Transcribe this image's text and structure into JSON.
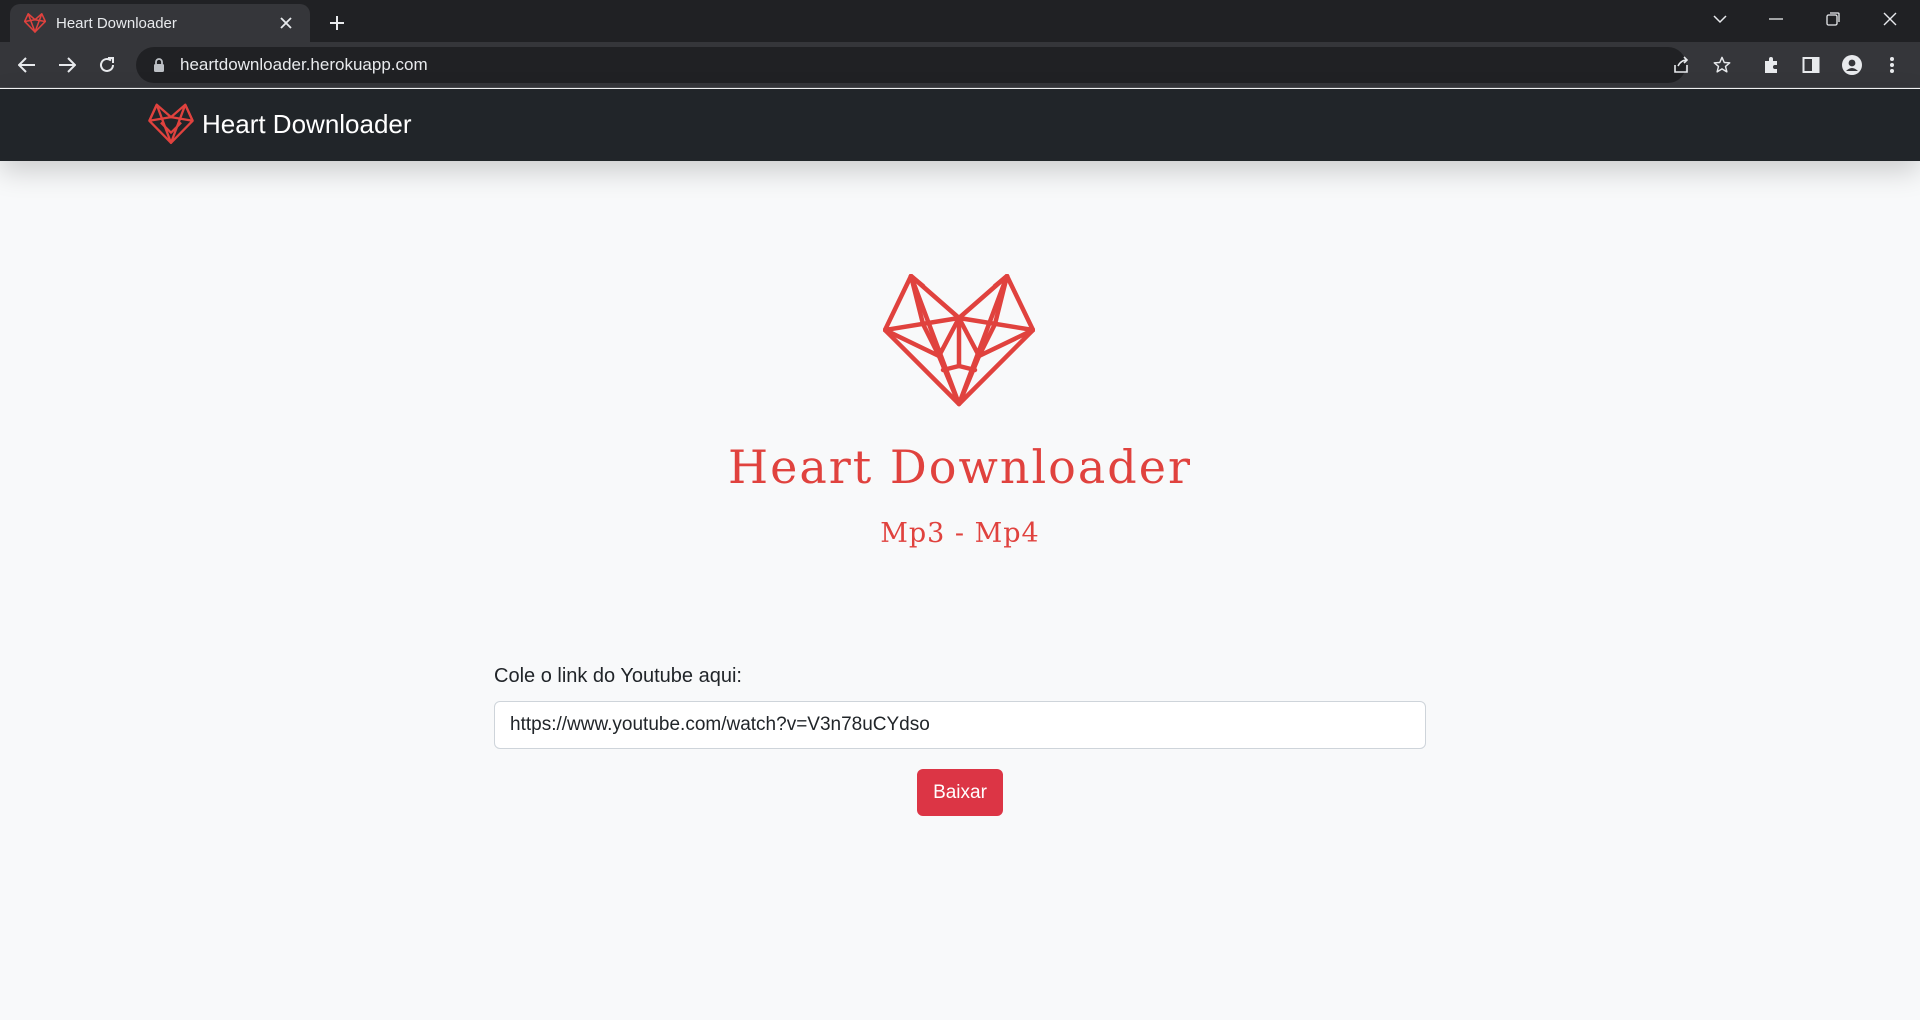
{
  "browser": {
    "tab_title": "Heart Downloader",
    "url": "heartdownloader.herokuapp.com"
  },
  "site": {
    "brand": "Heart Downloader",
    "title": "Heart Downloader",
    "subtitle": "Mp3 - Mp4",
    "form": {
      "label": "Cole o link do Youtube aqui:",
      "input_value": "https://www.youtube.com/watch?v=V3n78uCYdso",
      "submit_label": "Baixar"
    }
  },
  "colors": {
    "accent": "#e0423e",
    "button": "#dc3545",
    "navbar": "#212529"
  },
  "icons": [
    "heart-fox-logo-icon",
    "close-icon",
    "plus-icon",
    "back-icon",
    "forward-icon",
    "reload-icon",
    "lock-icon",
    "share-icon",
    "star-icon",
    "extensions-icon",
    "side-panel-icon",
    "profile-icon",
    "menu-icon"
  ]
}
